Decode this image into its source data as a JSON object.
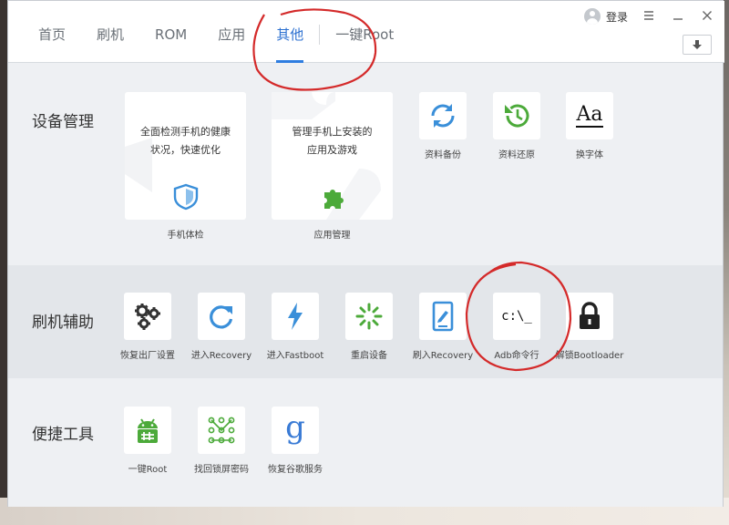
{
  "tabs": [
    {
      "label": "首页",
      "active": false
    },
    {
      "label": "刷机",
      "active": false
    },
    {
      "label": "ROM",
      "active": false
    },
    {
      "label": "应用",
      "active": false
    },
    {
      "label": "其他",
      "active": true
    },
    {
      "label": "一键Root",
      "active": false
    }
  ],
  "titlebar": {
    "login_label": "登录",
    "menu_icon": "menu-icon",
    "minimize_icon": "minimize-icon",
    "close_icon": "close-icon",
    "download_icon": "download-arrow-icon"
  },
  "sections": {
    "device": {
      "title": "设备管理",
      "cards": [
        {
          "desc_line1": "全面检测手机的健康",
          "desc_line2": "状况，快速优化",
          "label": "手机体检",
          "icon": "shield-icon"
        },
        {
          "desc_line1": "管理手机上安装的",
          "desc_line2": "应用及游戏",
          "label": "应用管理",
          "icon": "puzzle-icon"
        }
      ],
      "items": [
        {
          "label": "资料备份",
          "icon": "sync-icon"
        },
        {
          "label": "资料还原",
          "icon": "history-icon"
        },
        {
          "label": "换字体",
          "icon": "font-icon",
          "glyph": "Aa"
        }
      ]
    },
    "flash": {
      "title": "刷机辅助",
      "items": [
        {
          "label": "恢复出厂设置",
          "icon": "gears-icon"
        },
        {
          "label": "进入Recovery",
          "icon": "refresh-icon"
        },
        {
          "label": "进入Fastboot",
          "icon": "lightning-icon"
        },
        {
          "label": "重启设备",
          "icon": "loading-icon"
        },
        {
          "label": "刷入Recovery",
          "icon": "tablet-edit-icon"
        },
        {
          "label": "Adb命令行",
          "icon": "terminal-icon",
          "glyph": "c:\\_"
        },
        {
          "label": "解锁Bootloader",
          "icon": "lock-icon"
        }
      ]
    },
    "tools": {
      "title": "便捷工具",
      "items": [
        {
          "label": "一键Root",
          "icon": "android-root-icon"
        },
        {
          "label": "找回锁屏密码",
          "icon": "pattern-lock-icon"
        },
        {
          "label": "恢复谷歌服务",
          "icon": "google-icon",
          "glyph": "g"
        }
      ]
    }
  },
  "colors": {
    "accent": "#2e7de0",
    "icon_blue": "#3a8fd9",
    "icon_green": "#4caa3a",
    "annotation_red": "#d42a2a"
  }
}
